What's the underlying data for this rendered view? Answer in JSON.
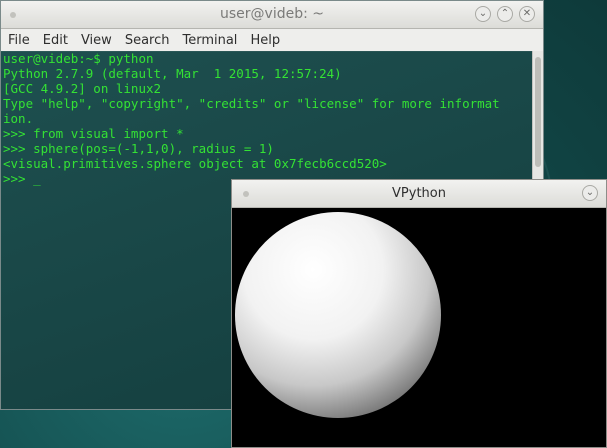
{
  "terminal": {
    "title": "user@videb: ~",
    "menu": [
      "File",
      "Edit",
      "View",
      "Search",
      "Terminal",
      "Help"
    ],
    "lines": [
      "user@videb:~$ python",
      "Python 2.7.9 (default, Mar  1 2015, 12:57:24)",
      "[GCC 4.9.2] on linux2",
      "Type \"help\", \"copyright\", \"credits\" or \"license\" for more informat",
      "ion.",
      ">>> from visual import *",
      ">>> sphere(pos=(-1,1,0), radius = 1)",
      "<visual.primitives.sphere object at 0x7fecb6ccd520>",
      ">>> "
    ],
    "cursor": "_",
    "text_color": "#34e234",
    "buttons": {
      "minimize": "⌄",
      "maximize": "⌃",
      "close": "✕"
    }
  },
  "vpython": {
    "title": "VPython",
    "menu_button": "⌄",
    "background_color": "#000000",
    "sphere_color": "#ffffff"
  }
}
